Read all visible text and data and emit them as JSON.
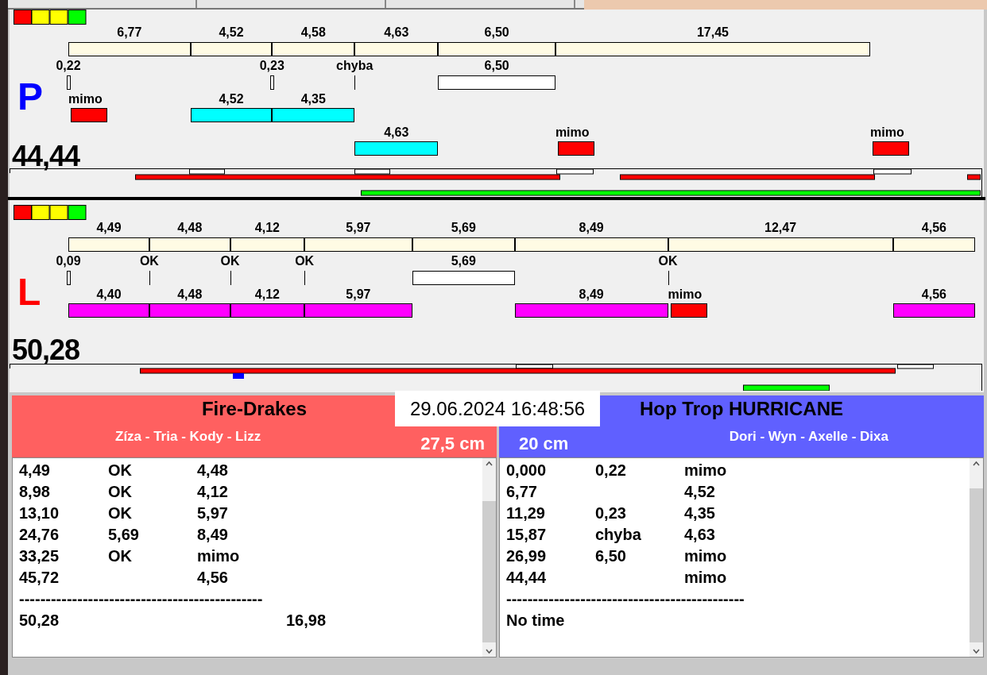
{
  "lanes": [
    {
      "letter": "P",
      "color": "#0000ff",
      "total": "44,44",
      "segments": [
        {
          "time": "6,77",
          "mark": {
            "kind": "small",
            "label": "0,22"
          },
          "row_1": {
            "kind": "miss",
            "label": "mimo"
          }
        },
        {
          "time": "4,52",
          "row_1": {
            "kind": "hit",
            "label": "4,52"
          }
        },
        {
          "time": "4,58",
          "mark": {
            "kind": "small",
            "label": "0,23"
          },
          "row_1": {
            "kind": "hit",
            "label": "4,35"
          }
        },
        {
          "time": "4,63",
          "mark": {
            "kind": "line",
            "label": "chyba"
          },
          "row_2": {
            "kind": "hit",
            "label": "4,63"
          }
        },
        {
          "time": "6,50",
          "mark": {
            "kind": "span",
            "label": "6,50"
          }
        },
        {
          "time": "17,45",
          "row_2": {
            "kind": "miss",
            "label": "mimo"
          }
        }
      ],
      "end": {
        "row_2": {
          "kind": "miss",
          "label": "mimo"
        }
      }
    },
    {
      "letter": "L",
      "color": "#ff0000",
      "total": "50,28",
      "segments": [
        {
          "time": "4,49",
          "mark": {
            "kind": "small",
            "label": "0,09"
          },
          "row_1": {
            "kind": "hit",
            "label": "4,40"
          }
        },
        {
          "time": "4,48",
          "mark": {
            "kind": "line",
            "label": "OK"
          },
          "row_1": {
            "kind": "hit",
            "label": "4,48"
          }
        },
        {
          "time": "4,12",
          "mark": {
            "kind": "line",
            "label": "OK"
          },
          "row_1": {
            "kind": "hit",
            "label": "4,12"
          }
        },
        {
          "time": "5,97",
          "mark": {
            "kind": "line",
            "label": "OK"
          },
          "row_1": {
            "kind": "hit",
            "label": "5,97"
          }
        },
        {
          "time": "5,69",
          "mark": {
            "kind": "span",
            "label": "5,69"
          }
        },
        {
          "time": "8,49",
          "row_1": {
            "kind": "hit",
            "label": "8,49"
          }
        },
        {
          "time": "12,47",
          "mark": {
            "kind": "line",
            "label": "OK"
          },
          "row_1": {
            "kind": "miss",
            "label": "mimo"
          }
        },
        {
          "time": "4,56",
          "row_1": {
            "kind": "hit",
            "label": "4,56"
          }
        }
      ]
    }
  ],
  "datetime": "29.06.2024 16:48:56",
  "teams": [
    {
      "name": "Fire-Drakes",
      "members": "Zíza - Tria - Kody - Lizz",
      "distance": "27,5 cm",
      "color": "#ff6060",
      "lines": [
        {
          "column_1": "4,49",
          "column_2": "OK",
          "column_3": "4,48"
        },
        {
          "column_1": "8,98",
          "column_2": "OK",
          "column_3": "4,12"
        },
        {
          "column_1": "13,10",
          "column_2": "OK",
          "column_3": "5,97"
        },
        {
          "column_1": "24,76",
          "column_2": "5,69",
          "column_3": "8,49"
        },
        {
          "column_1": "33,25",
          "column_2": "OK",
          "column_3": "mimo"
        },
        {
          "column_1": "45,72",
          "column_3": "4,56"
        }
      ],
      "separator": "----------------------------------------------",
      "total": {
        "column_1": "50,28",
        "column_4": "16,98"
      }
    },
    {
      "name": "Hop Trop HURRICANE",
      "members": "Dori - Wyn - Axelle - Dixa",
      "distance": "20 cm",
      "color": "#6060ff",
      "lines": [
        {
          "column_1": "0,000",
          "column_2": "0,22",
          "column_3": "mimo"
        },
        {
          "column_1": "6,77",
          "column_3": "4,52"
        },
        {
          "column_1": "11,29",
          "column_2": "0,23",
          "column_3": "4,35"
        },
        {
          "column_1": "15,87",
          "column_2": "chyba",
          "column_3": "4,63"
        },
        {
          "column_1": "26,99",
          "column_2": "6,50",
          "column_3": "mimo"
        },
        {
          "column_1": "44,44",
          "column_3": "mimo"
        }
      ],
      "separator": "---------------------------------------------",
      "total": {
        "column_1": "No time"
      }
    }
  ]
}
